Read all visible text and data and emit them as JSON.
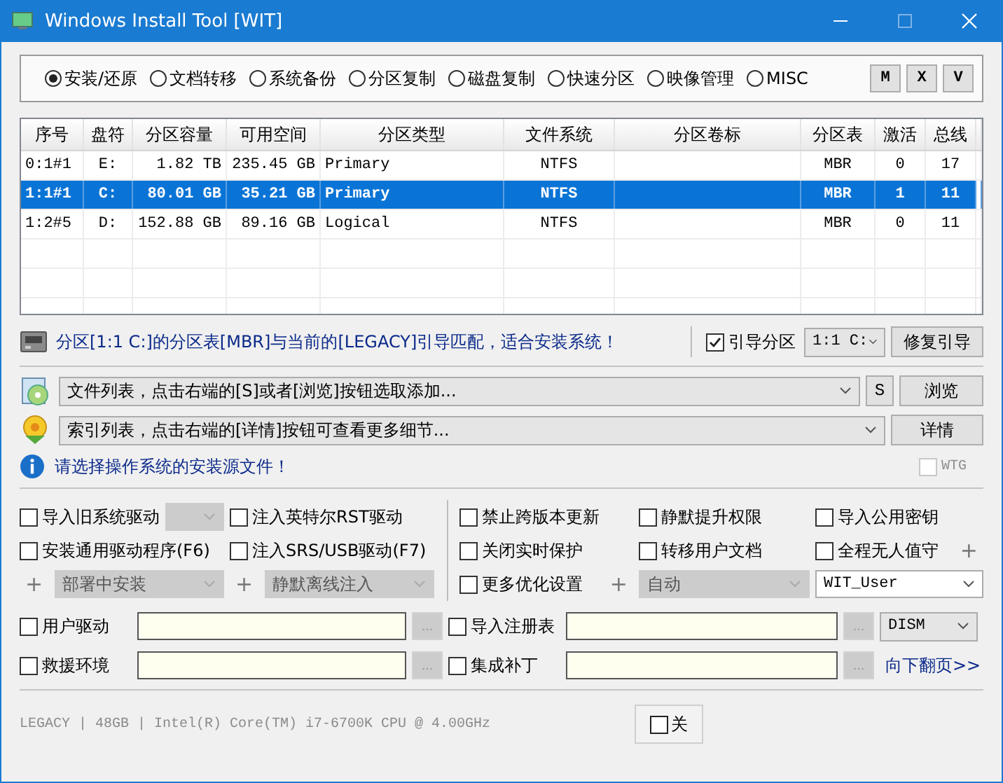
{
  "window": {
    "title": "Windows Install Tool [WIT]"
  },
  "modes": [
    {
      "label": "安装/还原",
      "selected": true
    },
    {
      "label": "文档转移",
      "selected": false
    },
    {
      "label": "系统备份",
      "selected": false
    },
    {
      "label": "分区复制",
      "selected": false
    },
    {
      "label": "磁盘复制",
      "selected": false
    },
    {
      "label": "快速分区",
      "selected": false
    },
    {
      "label": "映像管理",
      "selected": false
    },
    {
      "label": "MISC",
      "selected": false
    }
  ],
  "mode_buttons": [
    "M",
    "X",
    "V"
  ],
  "table": {
    "columns": [
      "序号",
      "盘符",
      "分区容量",
      "可用空间",
      "分区类型",
      "文件系统",
      "分区卷标",
      "分区表",
      "激活",
      "总线"
    ],
    "rows": [
      {
        "cells": [
          "0:1#1",
          "E:",
          "1.82 TB",
          "235.45 GB",
          "Primary",
          "NTFS",
          "",
          "MBR",
          "0",
          "17"
        ],
        "selected": false
      },
      {
        "cells": [
          "1:1#1",
          "C:",
          "80.01 GB",
          "35.21 GB",
          "Primary",
          "NTFS",
          "",
          "MBR",
          "1",
          "11"
        ],
        "selected": true
      },
      {
        "cells": [
          "1:2#5",
          "D:",
          "152.88 GB",
          "89.16 GB",
          "Logical",
          "NTFS",
          "",
          "MBR",
          "0",
          "11"
        ],
        "selected": false
      }
    ]
  },
  "status": {
    "message": "分区[1:1 C:]的分区表[MBR]与当前的[LEGACY]引导匹配，适合安装系统！",
    "boot_partition": {
      "label": "引导分区",
      "checked": true
    },
    "partition_select": "1:1 C:",
    "repair_button": "修复引导"
  },
  "file_list": {
    "value": "文件列表，点击右端的[S]或者[浏览]按钮选取添加...",
    "buttons": [
      "S",
      "浏览"
    ]
  },
  "index_list": {
    "value": "索引列表，点击右端的[详情]按钮可查看更多细节...",
    "button": "详情"
  },
  "info": {
    "message": "请选择操作系统的安装源文件！",
    "wtg": {
      "label": "WTG",
      "checked": false,
      "disabled": true
    }
  },
  "options": [
    {
      "cells": [
        [
          {
            "kind": "checkbox",
            "label": "导入旧系统驱动",
            "checked": false
          },
          {
            "kind": "combo",
            "disabled": true
          }
        ],
        [
          {
            "kind": "checkbox",
            "label": "注入英特尔RST驱动",
            "checked": false
          }
        ],
        [
          {
            "kind": "checkbox",
            "label": "禁止跨版本更新",
            "checked": false
          }
        ],
        [
          {
            "kind": "checkbox",
            "label": "静默提升权限",
            "checked": false
          }
        ],
        [
          {
            "kind": "checkbox",
            "label": "导入公用密钥",
            "checked": false
          }
        ]
      ]
    },
    {
      "cells": [
        [
          {
            "kind": "checkbox",
            "label": "安装通用驱动程序(F6)",
            "checked": false
          }
        ],
        [
          {
            "kind": "checkbox",
            "label": "注入SRS/USB驱动(F7)",
            "checked": false
          }
        ],
        [
          {
            "kind": "checkbox",
            "label": "关闭实时保护",
            "checked": false
          }
        ],
        [
          {
            "kind": "checkbox",
            "label": "转移用户文档",
            "checked": false
          }
        ],
        [
          {
            "kind": "checkbox",
            "label": "全程无人值守",
            "checked": false
          },
          {
            "kind": "plus",
            "text": "+"
          }
        ]
      ]
    },
    {
      "cells": [
        [
          {
            "kind": "plus",
            "text": "+"
          },
          {
            "kind": "combo",
            "value": "部署中安装",
            "disabled": true
          }
        ],
        [
          {
            "kind": "plus",
            "text": "+"
          },
          {
            "kind": "combo",
            "value": "静默离线注入",
            "disabled": true
          }
        ],
        [
          {
            "kind": "checkbox",
            "label": "更多优化设置",
            "checked": false
          },
          {
            "kind": "plus",
            "text": "+"
          }
        ],
        [
          {
            "kind": "combo",
            "value": "自动",
            "disabled": true
          }
        ],
        [
          {
            "kind": "combo",
            "value": "WIT_User",
            "disabled": false
          }
        ]
      ]
    }
  ],
  "extra_rows": [
    [
      {
        "kind": "checkbox",
        "label": "用户驱动",
        "checked": false
      },
      {
        "kind": "field"
      },
      {
        "kind": "browse",
        "label": "...",
        "disabled": true
      },
      {
        "kind": "checkbox",
        "label": "导入注册表",
        "checked": false
      },
      {
        "kind": "field"
      },
      {
        "kind": "browse",
        "label": "...",
        "disabled": true
      },
      {
        "kind": "combo",
        "value": "DISM",
        "disabled": false
      }
    ],
    [
      {
        "kind": "checkbox",
        "label": "救援环境",
        "checked": false
      },
      {
        "kind": "field"
      },
      {
        "kind": "browse",
        "label": "...",
        "disabled": true
      },
      {
        "kind": "checkbox",
        "label": "集成补丁",
        "checked": false
      },
      {
        "kind": "field"
      },
      {
        "kind": "browse",
        "label": "...",
        "disabled": true
      },
      {
        "kind": "link",
        "label": "向下翻页>>"
      }
    ]
  ],
  "footer": {
    "system_info": "LEGACY | 48GB | Intel(R) Core(TM) i7-6700K CPU @ 4.00GHz",
    "button": {
      "label": "关",
      "checked": false
    }
  }
}
